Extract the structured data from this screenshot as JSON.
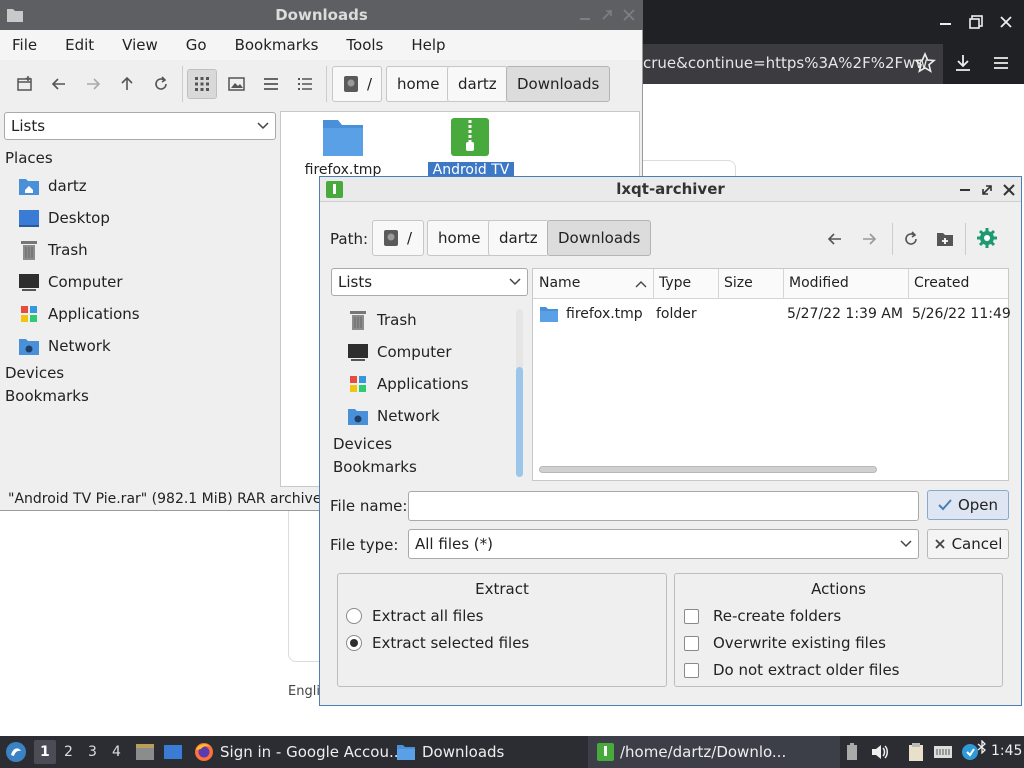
{
  "browser": {
    "url_fragment": "crue&continue=https%3A%2F%2Fww",
    "language_snippet": "Englis"
  },
  "file_manager": {
    "title": "Downloads",
    "menu": [
      "File",
      "Edit",
      "View",
      "Go",
      "Bookmarks",
      "Tools",
      "Help"
    ],
    "path": [
      "/",
      "home",
      "dartz",
      "Downloads"
    ],
    "side_select": "Lists",
    "places_heading": "Places",
    "places": [
      {
        "label": "dartz",
        "icon": "home-folder-icon"
      },
      {
        "label": "Desktop",
        "icon": "desktop-icon"
      },
      {
        "label": "Trash",
        "icon": "trash-icon"
      },
      {
        "label": "Computer",
        "icon": "computer-icon"
      },
      {
        "label": "Applications",
        "icon": "applications-icon"
      },
      {
        "label": "Network",
        "icon": "network-icon"
      }
    ],
    "devices_heading": "Devices",
    "bookmarks_heading": "Bookmarks",
    "files": [
      {
        "name": "firefox.tmp",
        "icon": "folder-icon"
      },
      {
        "name": "Android TV",
        "icon": "archive-icon",
        "selected": true
      }
    ],
    "status": "\"Android TV Pie.rar\" (982.1 MiB) RAR archive"
  },
  "dialog": {
    "title": "lxqt-archiver",
    "path_label": "Path:",
    "path": [
      "/",
      "home",
      "dartz",
      "Downloads"
    ],
    "side_select": "Lists",
    "places": [
      {
        "label": "Trash",
        "icon": "trash-icon"
      },
      {
        "label": "Computer",
        "icon": "computer-icon"
      },
      {
        "label": "Applications",
        "icon": "applications-icon"
      },
      {
        "label": "Network",
        "icon": "network-icon"
      }
    ],
    "devices_heading": "Devices",
    "bookmarks_heading": "Bookmarks",
    "columns": [
      "Name",
      "Type",
      "Size",
      "Modified",
      "Created"
    ],
    "rows": [
      {
        "name": "firefox.tmp",
        "type": "folder",
        "size": "",
        "modified": "5/27/22 1:39 AM",
        "created": "5/26/22 11:49"
      }
    ],
    "file_name_label": "File name:",
    "file_name_value": "",
    "file_type_label": "File type:",
    "file_type_value": "All files (*)",
    "open_label": "Open",
    "cancel_label": "Cancel",
    "extract": {
      "title": "Extract",
      "options": [
        {
          "label": "Extract all files",
          "selected": false
        },
        {
          "label": "Extract selected files",
          "selected": true
        }
      ]
    },
    "actions": {
      "title": "Actions",
      "options": [
        {
          "label": "Re-create folders",
          "checked": false
        },
        {
          "label": "Overwrite existing files",
          "checked": false
        },
        {
          "label": "Do not extract older files",
          "checked": false
        }
      ]
    }
  },
  "taskbar": {
    "desktops": [
      "1",
      "2",
      "3",
      "4"
    ],
    "active_desktop": "1",
    "tasks": [
      {
        "label": "Sign in - Google Accou...",
        "icon": "firefox-icon"
      },
      {
        "label": "Downloads",
        "icon": "folder-icon"
      },
      {
        "label": "/home/dartz/Downlo...",
        "icon": "archive-icon"
      }
    ],
    "clock": "1:45"
  },
  "colors": {
    "accent": "#4a7fb5",
    "folder_blue": "#4a90d9",
    "archive_green": "#48a93c",
    "selection": "#3d78c6",
    "taskbar": "#2b2d33",
    "titlebar_dark": "#5d5f63"
  }
}
